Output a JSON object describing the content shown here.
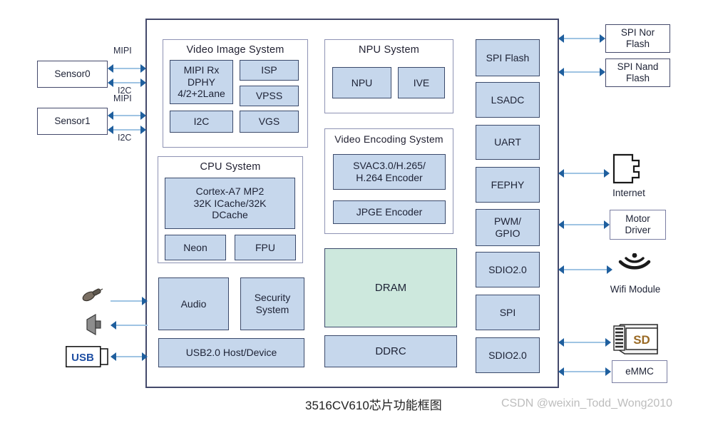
{
  "caption": "3516CV610芯片功能框图",
  "watermark": "CSDN @weixin_Todd_Wong2010",
  "colors": {
    "block_fill": "#c6d7ec",
    "block_border": "#3b4a6b",
    "dram_fill": "#cde8dd",
    "chip_border": "#44496b",
    "arrow_head": "#1f5f9e",
    "arrow_line": "#9fc4e3"
  },
  "chip": {
    "groups": {
      "video_image_system": {
        "title": "Video Image System",
        "blocks": [
          {
            "label": "MIPI Rx\nDPHY\n4/2+2Lane"
          },
          {
            "label": "ISP"
          },
          {
            "label": "VPSS"
          },
          {
            "label": "I2C"
          },
          {
            "label": "VGS"
          }
        ]
      },
      "cpu_system": {
        "title": "CPU System",
        "blocks": [
          {
            "label": "Cortex-A7 MP2\n32K ICache/32K\nDCache"
          },
          {
            "label": "Neon"
          },
          {
            "label": "FPU"
          }
        ]
      },
      "npu_system": {
        "title": "NPU System",
        "blocks": [
          {
            "label": "NPU"
          },
          {
            "label": "IVE"
          }
        ]
      },
      "video_encoding_system": {
        "title": "Video Encoding System",
        "blocks": [
          {
            "label": "SVAC3.0/H.265/\nH.264 Encoder"
          },
          {
            "label": "JPGE Encoder"
          }
        ]
      }
    },
    "standalone_blocks": [
      {
        "label": "Audio"
      },
      {
        "label": "Security\nSystem"
      },
      {
        "label": "USB2.0 Host/Device"
      },
      {
        "label": "DRAM"
      },
      {
        "label": "DDRC"
      }
    ],
    "peripherals": [
      {
        "label": "SPI Flash"
      },
      {
        "label": "LSADC"
      },
      {
        "label": "UART"
      },
      {
        "label": "FEPHY"
      },
      {
        "label": "PWM/\nGPIO"
      },
      {
        "label": "SDIO2.0"
      },
      {
        "label": "SPI"
      },
      {
        "label": "SDIO2.0"
      }
    ]
  },
  "left_devices": [
    {
      "label": "Sensor0",
      "buses": [
        "MIPI",
        "I2C"
      ]
    },
    {
      "label": "Sensor1",
      "buses": [
        "MIPI",
        "I2C"
      ]
    }
  ],
  "left_icons": [
    {
      "name": "microphone-icon",
      "label": ""
    },
    {
      "name": "speaker-icon",
      "label": ""
    },
    {
      "name": "usb-connector-icon",
      "label": "USB"
    }
  ],
  "right_devices": [
    {
      "label": "SPI Nor\nFlash",
      "kind": "box"
    },
    {
      "label": "SPI Nand\nFlash",
      "kind": "box"
    },
    {
      "label": "Internet",
      "kind": "icon-rj45"
    },
    {
      "label": "Motor\nDriver",
      "kind": "box"
    },
    {
      "label": "Wifi Module",
      "kind": "icon-wifi"
    },
    {
      "label": "SD",
      "kind": "icon-sdcard"
    },
    {
      "label": "eMMC",
      "kind": "box"
    }
  ]
}
